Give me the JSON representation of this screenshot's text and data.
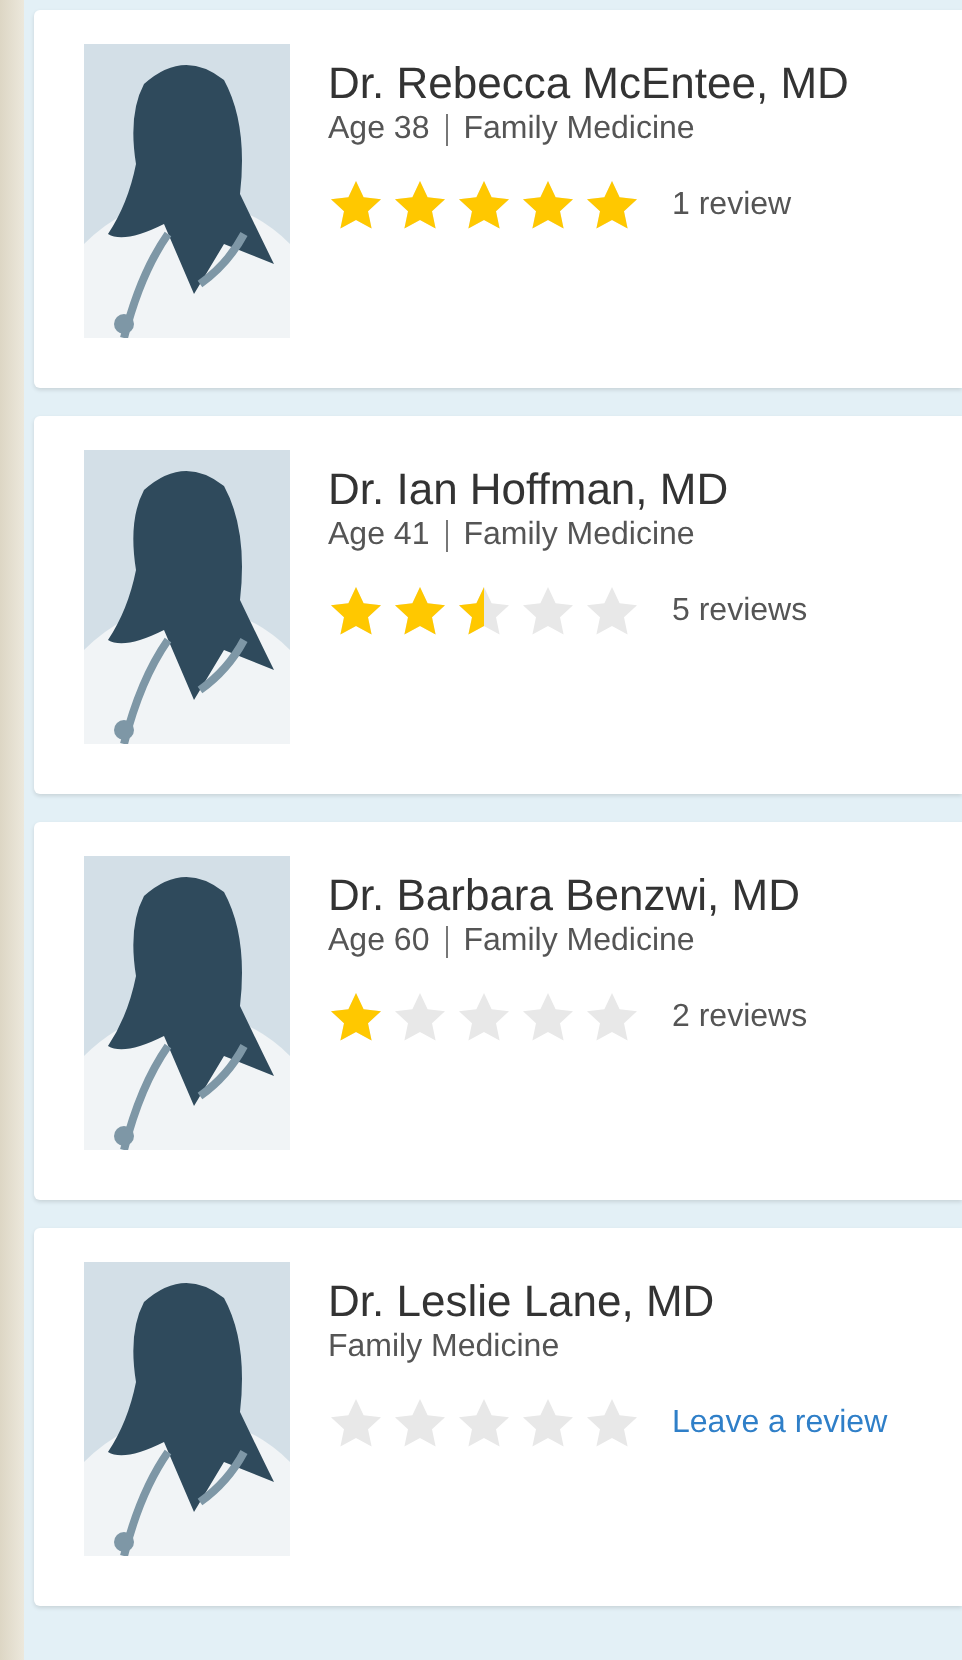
{
  "doctors": [
    {
      "name": "Dr. Rebecca McEntee, MD",
      "age": "Age 38",
      "specialty": "Family Medicine",
      "stars": 5,
      "reviews": {
        "kind": "count",
        "text": "1 review"
      }
    },
    {
      "name": "Dr. Ian Hoffman, MD",
      "age": "Age 41",
      "specialty": "Family Medicine",
      "stars": 2.5,
      "reviews": {
        "kind": "count",
        "text": "5 reviews"
      }
    },
    {
      "name": "Dr. Barbara Benzwi, MD",
      "age": "Age 60",
      "specialty": "Family Medicine",
      "stars": 1,
      "reviews": {
        "kind": "count",
        "text": "2 reviews"
      }
    },
    {
      "name": "Dr. Leslie Lane, MD",
      "specialty": "Family Medicine",
      "stars": 0,
      "reviews": {
        "kind": "link",
        "text": "Leave a review"
      }
    }
  ]
}
